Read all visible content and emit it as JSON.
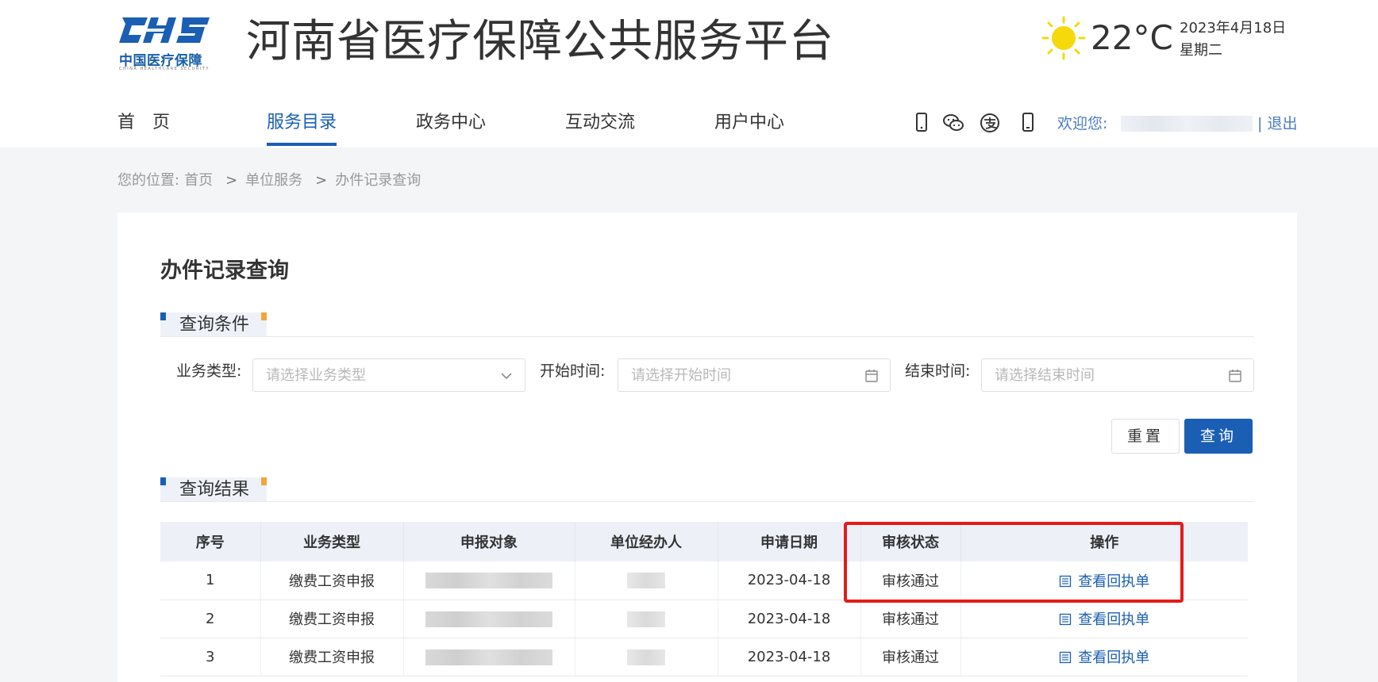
{
  "logo": {
    "mark_text": "CHS",
    "cn": "中国医疗保障",
    "en": "CHINA HEALTHCARE SECURITY"
  },
  "site_title": "河南省医疗保障公共服务平台",
  "weather": {
    "icon": "sun-icon",
    "temp": "22°C",
    "date": "2023年4月18日",
    "weekday": "星期二"
  },
  "nav": {
    "items": [
      {
        "label": "首　页"
      },
      {
        "label": "服务目录"
      },
      {
        "label": "政务中心"
      },
      {
        "label": "互动交流"
      },
      {
        "label": "用户中心"
      }
    ],
    "active_index": 1
  },
  "util_icons": [
    "mobile-icon",
    "wechat-icon",
    "alipay-icon",
    "phone-icon"
  ],
  "user": {
    "welcome": "欢迎您:",
    "logout": "| 退出"
  },
  "breadcrumb": {
    "prefix": "您的位置:",
    "items": [
      "首页",
      "单位服务",
      "办件记录查询"
    ],
    "separator": ">"
  },
  "page_title": "办件记录查询",
  "query_section": {
    "title": "查询条件",
    "fields": [
      {
        "label": "业务类型:",
        "placeholder": "请选择业务类型",
        "icon": "chevron-down-icon"
      },
      {
        "label": "开始时间:",
        "placeholder": "请选择开始时间",
        "icon": "calendar-icon"
      },
      {
        "label": "结束时间:",
        "placeholder": "请选择结束时间",
        "icon": "calendar-icon"
      }
    ],
    "reset_label": "重置",
    "query_label": "查询"
  },
  "result_section": {
    "title": "查询结果",
    "columns": [
      "序号",
      "业务类型",
      "申报对象",
      "单位经办人",
      "申请日期",
      "审核状态",
      "操作"
    ],
    "rows": [
      {
        "index": "1",
        "type": "缴费工资申报",
        "date": "2023-04-18",
        "status": "审核通过",
        "action": "查看回执单"
      },
      {
        "index": "2",
        "type": "缴费工资申报",
        "date": "2023-04-18",
        "status": "审核通过",
        "action": "查看回执单"
      },
      {
        "index": "3",
        "type": "缴费工资申报",
        "date": "2023-04-18",
        "status": "审核通过",
        "action": "查看回执单"
      }
    ]
  },
  "colors": {
    "primary": "#1a5fb4",
    "highlight": "#e41b1b",
    "accent": "#f0a63a"
  }
}
